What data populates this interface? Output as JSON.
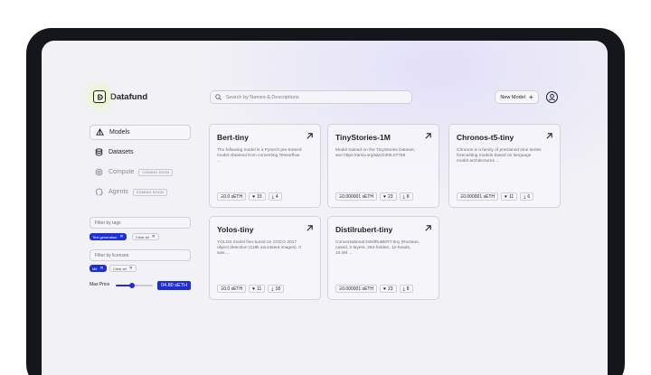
{
  "app": {
    "name": "Datafund"
  },
  "search": {
    "placeholder": "Search by Names & Descriptions"
  },
  "header": {
    "new_model_label": "New Model",
    "plus_glyph": "+"
  },
  "sidebar": {
    "items": [
      {
        "label": "Models",
        "icon": "pyramid-icon",
        "active": true,
        "badge": ""
      },
      {
        "label": "Datasets",
        "icon": "database-icon",
        "active": false,
        "badge": ""
      },
      {
        "label": "Compute",
        "icon": "chip-icon",
        "active": false,
        "badge": "COMING SOON"
      },
      {
        "label": "Agents",
        "icon": "head-icon",
        "active": false,
        "badge": "COMING SOON"
      }
    ]
  },
  "filters": {
    "tags_placeholder": "Filter by tags",
    "tags_selected": [
      "Text generation"
    ],
    "tags_clear": "Clear all",
    "licenses_placeholder": "Filter by licenses",
    "licenses_selected": [
      "Mit"
    ],
    "licenses_clear": "Clear all",
    "chip_close_glyph": "✕",
    "price_label": "Max Price",
    "price_value": "04.80 sETH",
    "price_slider_fraction": 0.45
  },
  "cards": [
    {
      "title": "Bert-tiny",
      "description": "The following model is a Pytorch pre-trained model obtained from converting Tensorflow ...",
      "price": "Ξ0.0 sETH",
      "likes": "15",
      "downloads": "4"
    },
    {
      "title": "TinyStories-1M",
      "description": "Model trained on the TinyStories Dataset, see https://arxiv.org/abs/2305.07759",
      "price": "Ξ0.000001 sETH",
      "likes": "23",
      "downloads": "8"
    },
    {
      "title": "Chronos-t5-tiny",
      "description": "Chronos is a family of pretrained time series forecasting models based on language model architectures ...",
      "price": "Ξ0.000001 sETH",
      "likes": "11",
      "downloads": "6"
    },
    {
      "title": "Yolos-tiny",
      "description": "YOLOS model fine-tuned on COCO 2017 object detection (118k annotated images). It was ...",
      "price": "Ξ0.0 sETH",
      "likes": "11",
      "downloads": "18"
    },
    {
      "title": "Distilrubert-tiny",
      "description": "Conversational DistilRuBERT-tiny (Russian, cased, 2-layers, 264-hidden, 12-heads, 10.4M ...",
      "price": "Ξ0.000001 sETH",
      "likes": "23",
      "downloads": "8"
    }
  ],
  "colors": {
    "accent": "#1f2fd8",
    "logo_glow": "#e6f7b8",
    "device": "#15161b"
  }
}
